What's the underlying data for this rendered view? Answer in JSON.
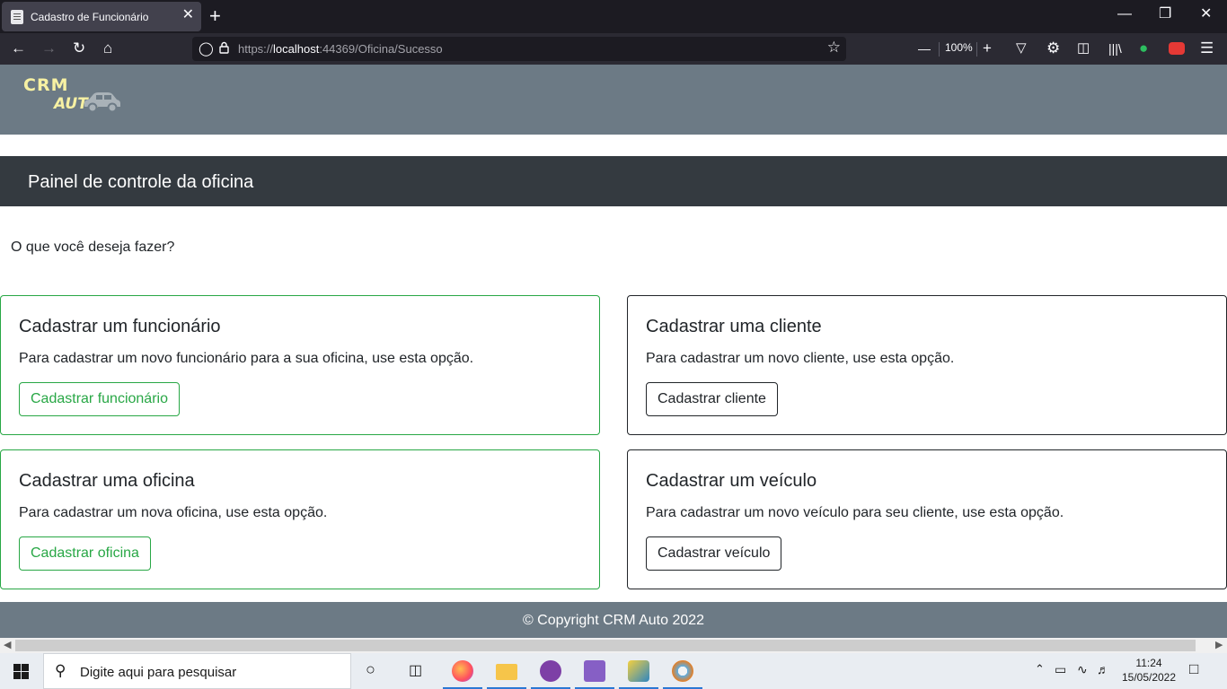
{
  "browser": {
    "tab_title": "Cadastro de Funcionário",
    "new_tab": "+",
    "close_tab": "✕",
    "url_scheme": "https://",
    "url_host": "localhost",
    "url_rest": ":44369/Oficina/Sucesso",
    "zoom_level": "100%",
    "zoom_out": "—",
    "zoom_in": "+"
  },
  "header": {
    "logo_line1": "CRM",
    "logo_line2": "AUTO"
  },
  "panel": {
    "title": "Painel de controle da oficina"
  },
  "main": {
    "question": "O que você deseja fazer?",
    "cards": [
      {
        "title": "Cadastrar um funcionário",
        "description": "Para cadastrar um novo funcionário para a sua oficina, use esta opção.",
        "button": "Cadastrar funcionário",
        "style": "green"
      },
      {
        "title": "Cadastrar uma cliente",
        "description": "Para cadastrar um novo cliente, use esta opção.",
        "button": "Cadastrar cliente",
        "style": "dark"
      },
      {
        "title": "Cadastrar uma oficina",
        "description": "Para cadastrar um nova oficina, use esta opção.",
        "button": "Cadastrar oficina",
        "style": "green"
      },
      {
        "title": "Cadastrar um veículo",
        "description": "Para cadastrar um novo veículo para seu cliente, use esta opção.",
        "button": "Cadastrar veículo",
        "style": "dark"
      }
    ]
  },
  "footer": {
    "copyright": "© Copyright CRM Auto 2022"
  },
  "taskbar": {
    "search_placeholder": "Digite aqui para pesquisar",
    "time": "11:24",
    "date": "15/05/2022"
  },
  "colors": {
    "header_bg": "#6c7a85",
    "panel_bg": "#343a40",
    "success_green": "#28a745",
    "dark": "#212529",
    "logo_yellow": "#f7f1a3"
  }
}
